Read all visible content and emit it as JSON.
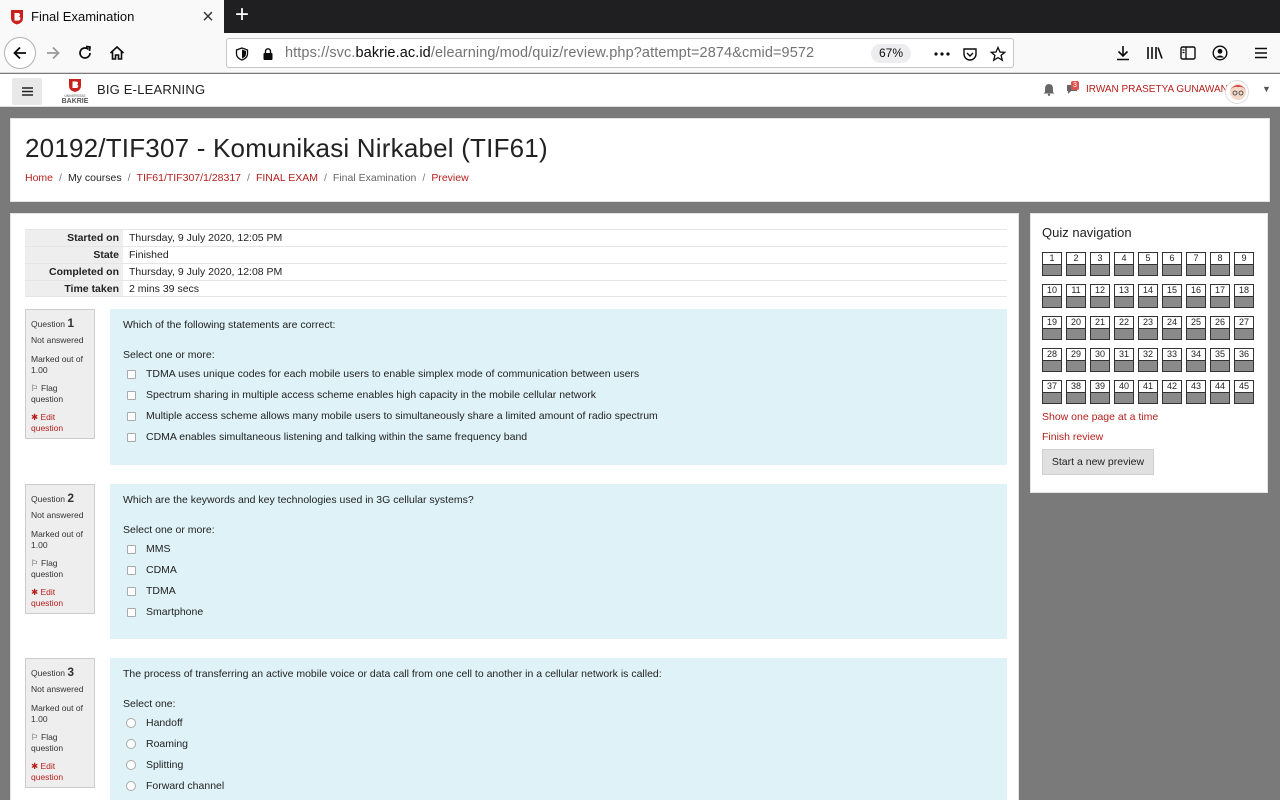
{
  "browser": {
    "tab_title": "Final Examination",
    "url_prefix": "https://svc.",
    "url_domain": "bakrie.ac.id",
    "url_path": "/elearning/mod/quiz/review.php?attempt=2874&cmid=9572",
    "zoom": "67%"
  },
  "navbar": {
    "brand_logo_text": "UNIVERSITAS BAKRIE",
    "brand_name": "BIG E-LEARNING",
    "message_count": "3",
    "username": "IRWAN PRASETYA GUNAWAN"
  },
  "header": {
    "course_title": "20192/TIF307 - Komunikasi Nirkabel (TIF61)",
    "breadcrumb": [
      "Home",
      "My courses",
      "TIF61/TIF307/1/28317",
      "FINAL EXAM",
      "Final Examination",
      "Preview"
    ]
  },
  "summary": [
    {
      "label": "Started on",
      "value": "Thursday, 9 July 2020, 12:05 PM"
    },
    {
      "label": "State",
      "value": "Finished"
    },
    {
      "label": "Completed on",
      "value": "Thursday, 9 July 2020, 12:08 PM"
    },
    {
      "label": "Time taken",
      "value": "2 mins 39 secs"
    }
  ],
  "questions": [
    {
      "prefix": "Question",
      "number": "1",
      "state": "Not answered",
      "marked": "Marked out of 1.00",
      "flag": "Flag question",
      "edit": "Edit question",
      "text": "Which of the following statements are correct:",
      "prompt": "Select one or more:",
      "options": [
        "TDMA uses unique codes for each mobile users to enable simplex mode of communication between users",
        "Spectrum sharing in multiple access scheme enables high capacity in the mobile cellular network",
        "Multiple access scheme allows many mobile users to simultaneously share a limited amount of radio spectrum",
        "CDMA enables simultaneous listening and talking within the same frequency band"
      ]
    },
    {
      "prefix": "Question",
      "number": "2",
      "state": "Not answered",
      "marked": "Marked out of 1.00",
      "flag": "Flag question",
      "edit": "Edit question",
      "text": "Which are the keywords and key technologies used in 3G cellular systems?",
      "prompt": "Select one or more:",
      "options": [
        "MMS",
        "CDMA",
        "TDMA",
        "Smartphone"
      ]
    },
    {
      "prefix": "Question",
      "number": "3",
      "state": "Not answered",
      "marked": "Marked out of 1.00",
      "flag": "Flag question",
      "edit": "Edit question",
      "text": "The process of transferring an active mobile voice or data call from one cell to another in a cellular network is called:",
      "prompt": "Select one:",
      "options": [
        "Handoff",
        "Roaming",
        "Splitting",
        "Forward channel"
      ]
    }
  ],
  "quiz_nav": {
    "title": "Quiz navigation",
    "buttons": [
      "1",
      "2",
      "3",
      "4",
      "5",
      "6",
      "7",
      "8",
      "9",
      "10",
      "11",
      "12",
      "13",
      "14",
      "15",
      "16",
      "17",
      "18",
      "19",
      "20",
      "21",
      "22",
      "23",
      "24",
      "25",
      "26",
      "27",
      "28",
      "29",
      "30",
      "31",
      "32",
      "33",
      "34",
      "35",
      "36",
      "37",
      "38",
      "39",
      "40",
      "41",
      "42",
      "43",
      "44",
      "45"
    ],
    "show_one_page": "Show one page at a time",
    "finish_review": "Finish review",
    "start_new_preview": "Start a new preview"
  },
  "colors": {
    "link": "#b5201d",
    "question_bg": "#def2f8",
    "info_bg": "#eeeeee",
    "page_bg": "#7a7a7a"
  }
}
